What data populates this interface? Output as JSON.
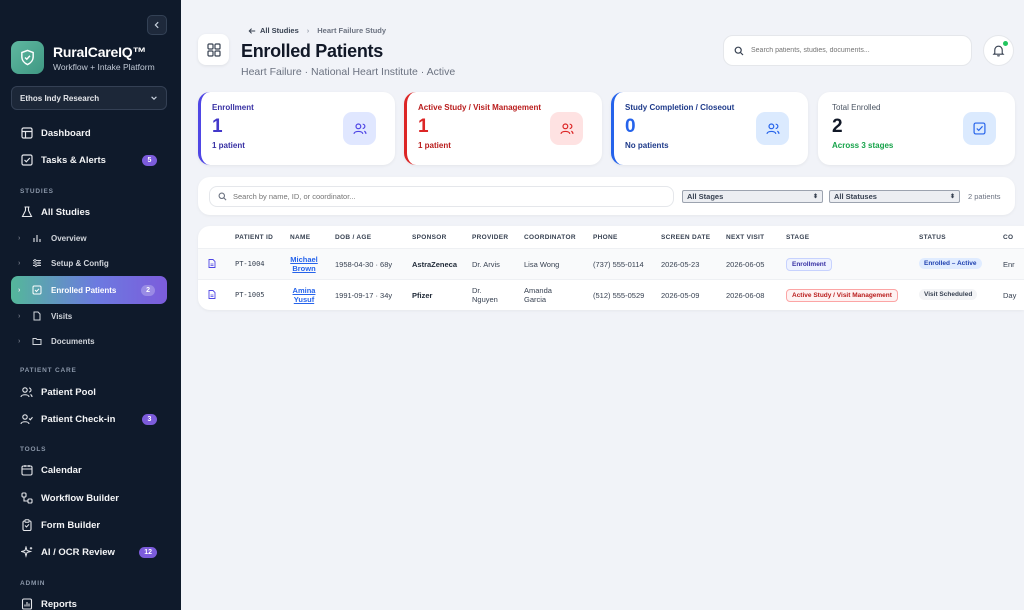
{
  "sidebar": {
    "brand_name": "RuralCareIQ™",
    "brand_sub": "Workflow + Intake Platform",
    "org": "Ethos Indy Research",
    "sections": {
      "studies": "STUDIES",
      "patient_care": "PATIENT CARE",
      "tools": "TOOLS",
      "admin": "ADMIN"
    },
    "items": {
      "dashboard": "Dashboard",
      "tasks": "Tasks & Alerts",
      "tasks_count": "5",
      "all_studies": "All Studies",
      "overview": "Overview",
      "setup": "Setup & Config",
      "enrolled": "Enrolled Patients",
      "enrolled_count": "2",
      "visits": "Visits",
      "documents": "Documents",
      "patient_pool": "Patient Pool",
      "checkin": "Patient Check-in",
      "checkin_count": "3",
      "calendar": "Calendar",
      "workflow": "Workflow Builder",
      "form_builder": "Form Builder",
      "ai_review": "AI / OCR Review",
      "ai_count": "12",
      "reports": "Reports"
    }
  },
  "header": {
    "back_label": "All Studies",
    "crumb": "Heart Failure Study",
    "title": "Enrolled Patients",
    "subtitle": "Heart Failure · National Heart Institute · Active",
    "search_placeholder": "Search patients, studies, documents..."
  },
  "cards": [
    {
      "label": "Enrollment",
      "value": "1",
      "note": "1 patient"
    },
    {
      "label": "Active Study / Visit Management",
      "value": "1",
      "note": "1 patient"
    },
    {
      "label": "Study Completion / Closeout",
      "value": "0",
      "note": "No patients"
    },
    {
      "label": "Total Enrolled",
      "value": "2",
      "note": "Across 3 stages"
    }
  ],
  "filters": {
    "search_placeholder": "Search by name, ID, or coordinator...",
    "stage": "All Stages",
    "status": "All Statuses",
    "count": "2 patients"
  },
  "table": {
    "columns": [
      "PATIENT ID",
      "NAME",
      "DOB / AGE",
      "SPONSOR",
      "PROVIDER",
      "COORDINATOR",
      "PHONE",
      "SCREEN DATE",
      "NEXT VISIT",
      "STAGE",
      "STATUS",
      "CO"
    ],
    "rows": [
      {
        "id": "PT-1004",
        "first": "Michael",
        "last": "Brown",
        "dob": "1958-04-30 · 68y",
        "sponsor": "AstraZeneca",
        "provider": "Dr. Arvis",
        "coordinator": "Lisa Wong",
        "coordinator2": "",
        "phone": "(737) 555-0114",
        "screen": "2026-05-23",
        "next": "2026-06-05",
        "stage": "Enrollment",
        "status": "Enrolled – Active",
        "extra": "Enr"
      },
      {
        "id": "PT-1005",
        "first": "Amina",
        "last": "Yusuf",
        "dob": "1991-09-17 · 34y",
        "sponsor": "Pfizer",
        "provider": "Dr.",
        "provider2": "Nguyen",
        "coordinator": "Amanda",
        "coordinator2": "Garcia",
        "phone": "(512) 555-0529",
        "screen": "2026-05-09",
        "next": "2026-06-08",
        "stage": "Active Study / Visit Management",
        "status": "Visit Scheduled",
        "extra": "Day"
      }
    ]
  },
  "colors": {
    "enrollment": "#4f46e5",
    "active": "#dc2626",
    "closeout": "#2563eb",
    "total_note": "#16a34a",
    "sidebar_bg": "#0f1a2b"
  }
}
